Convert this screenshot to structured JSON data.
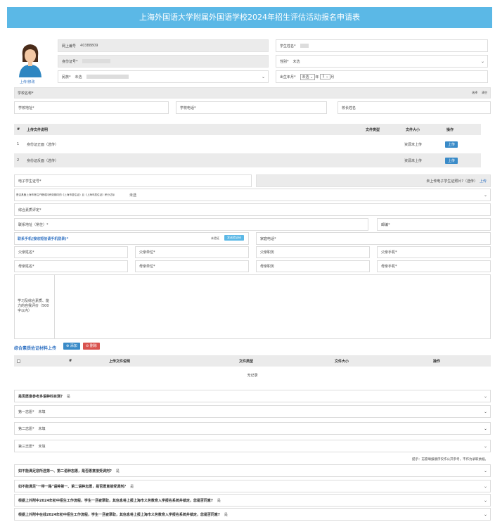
{
  "title": "上海外国语大学附属外国语学校2024年招生评估活动报名申请表",
  "photo": {
    "upload_label": "上传/修改"
  },
  "basic": {
    "net_id_label": "网上编号",
    "net_id_value": "40388809",
    "name_label": "学生姓名*",
    "name_value": "",
    "id_label": "身份证号*",
    "id_value": "",
    "gender_label": "性别*",
    "gender_value": "未选",
    "ethnic_label": "民族*",
    "ethnic_value": "未选",
    "birth_label": "出生年月*",
    "birth_year": "未选",
    "birth_year_suffix": "年",
    "birth_month": "1",
    "birth_month_suffix": "月"
  },
  "school": {
    "name_label": "学校名称*",
    "name_value": "",
    "select_label": "选择",
    "clear_label": "清空",
    "addr_label": "学校地址*",
    "phone_label": "学校电话*",
    "principal_label": "校长姓名"
  },
  "files": {
    "headers": [
      "#",
      "上传文件说明",
      "文件类型",
      "文件大小",
      "操作"
    ],
    "rows": [
      {
        "no": "1",
        "desc": "身份证正面（选传）",
        "status": "资源未上传",
        "action": "上传"
      },
      {
        "no": "2",
        "desc": "身份证反面（选传）",
        "status": "资源未上传",
        "action": "上传"
      }
    ]
  },
  "ecard": {
    "label": "电子学生证号*",
    "note": "未上传电子学生证照片?（选传）",
    "note_link": "上传"
  },
  "hukou": {
    "label": "是否具备上海市常住户籍或持有效期内的《上海市居住证》且《上海市居住证》积分达标",
    "value": "未选"
  },
  "review_label": "综合素质评定*",
  "contact": {
    "addr_label": "联系地址（常住）*",
    "zip_label": "邮编*",
    "phone_title": "联系手机(接收短信请手机登录)*",
    "unverified": "未验证",
    "verify_btn": "发送验证码",
    "home_phone_label": "家庭电话*"
  },
  "parents": [
    [
      "父亲姓名*",
      "父亲单位*",
      "父亲职务",
      "父亲手机*"
    ],
    [
      "母亲姓名*",
      "母亲单位*",
      "母亲职务",
      "母亲手机*"
    ]
  ],
  "study": {
    "label": "学习及综合素质、能力的自我评价（500字以内）"
  },
  "materials": {
    "title": "综合素质佐证材料上传",
    "add_btn": "添加",
    "del_btn": "删除",
    "headers": [
      "#",
      "上传文件说明",
      "文件类型",
      "文件大小",
      "操作"
    ],
    "empty": "无记录"
  },
  "lang": {
    "label": "是否愿意参考多语种科目测?",
    "value": "是"
  },
  "choices": [
    {
      "label": "第一志愿*",
      "value": "未填"
    },
    {
      "label": "第二志愿*",
      "value": "未填"
    },
    {
      "label": "第三志愿*",
      "value": "未填"
    }
  ],
  "hint": "提示：志愿填报顺序仅作公开参考，不作为录取依据。",
  "questions": [
    {
      "label": "如不能满足您所选第一、第二语种志愿，是否愿意接受调剂?",
      "value": "是"
    },
    {
      "label": "如不能满足\"一带一路\"语种第一、第二语种志愿，是否愿意接受调剂?",
      "value": "是"
    },
    {
      "label": "根据上外附中2024年初中招生工作流程，学生一旦被录取，其信息将上报上海市义务教育入学报名系统并锁定，您是否同意?",
      "value": "是"
    },
    {
      "label": "根据上外附中在线2024年初中招生工作流程，学生一旦被录取，其信息将上报上海市义务教育入学报名系统并锁定，您是否同意?",
      "value": "是"
    }
  ]
}
